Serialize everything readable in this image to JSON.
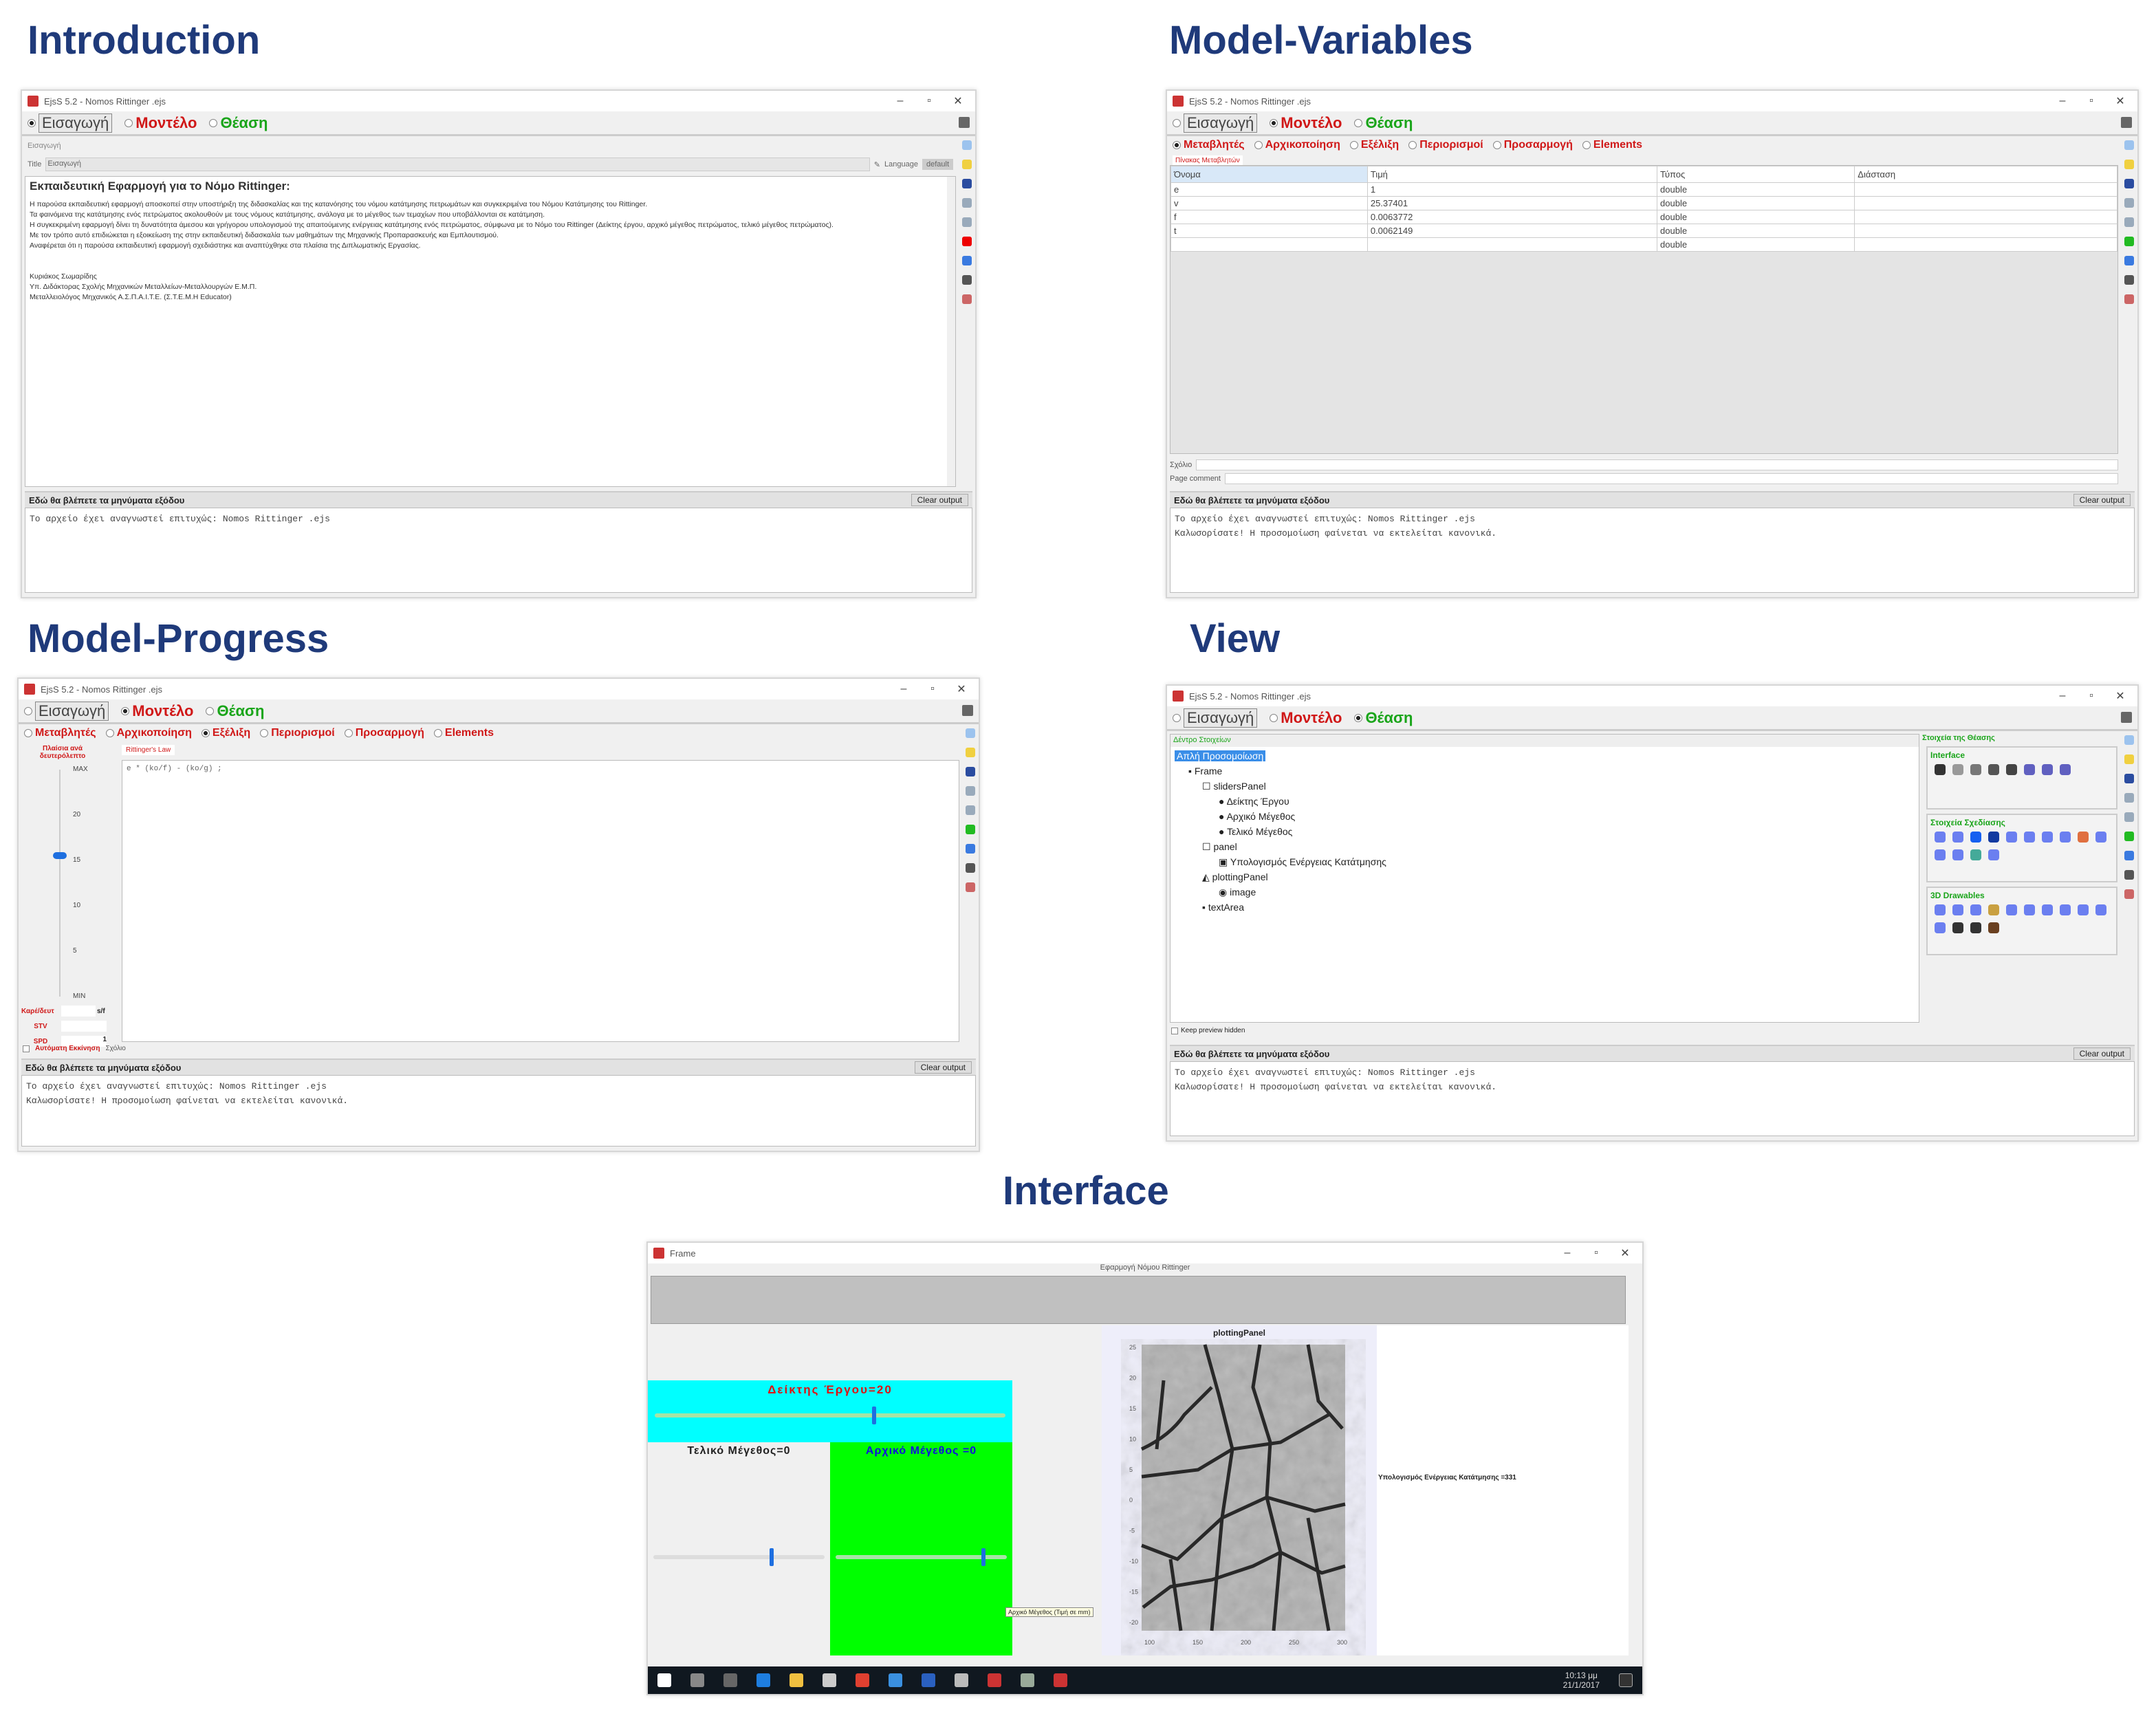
{
  "sections": {
    "introduction": "Introduction",
    "model_variables": "Model-Variables",
    "model_progress": "Model-Progress",
    "view": "View",
    "interface": "Interface"
  },
  "window_title": "EjsS 5.2 - Nomos Rittinger .ejs",
  "modes": {
    "intro": "Εισαγωγή",
    "model": "Μοντέλο",
    "view": "Θέαση"
  },
  "model_tabs": [
    "Μεταβλητές",
    "Αρχικοποίηση",
    "Εξέλιξη",
    "Περιορισμοί",
    "Προσαρμογή",
    "Elements"
  ],
  "output": {
    "header": "Εδώ θα βλέπετε τα μηνύματα εξόδου",
    "clear": "Clear output",
    "line1": "Το αρχείο έχει αναγνωστεί επιτυχώς: Nomos Rittinger .ejs",
    "line2": "Καλωσορίσατε! Η προσομοίωση φαίνεται να εκτελείται κανονικά."
  },
  "intro": {
    "page_tab": "Εισαγωγή",
    "title_label": "Title",
    "title_value": "Εισαγωγή",
    "language_label": "Language",
    "language_value": "default",
    "heading": "Εκπαιδευτική Εφαρμογή για το Νόμο Rittinger:",
    "paragraphs": [
      "Η παρούσα εκπαιδευτική εφαρμογή αποσκοπεί στην υποστήριξη της διδασκαλίας και της κατανόησης του νόμου κατάτμησης πετρωμάτων και συγκεκριμένα του Νόμου Κατάτμησης του Rittinger.",
      "Τα φαινόμενα της κατάτμησης ενός πετρώματος ακολουθούν με τους νόμους κατάτμησης, ανάλογα με το μέγεθος των τεμαχίων που υποβάλλονται σε κατάτμηση.",
      "Η συγκεκριμένη εφαρμογή δίνει τη δυνατότητα άμεσου και γρήγορου υπολογισμού της απαιτούμενης ενέργειας κατάτμησης ενός πετρώματος, σύμφωνα με το Νόμο του Rittinger (Δείκτης έργου, αρχικό μέγεθος πετρώματος, τελικό μέγεθος πετρώματος).",
      "Με τον τρόπο αυτό επιδιώκεται η εξοικείωση της στην εκπαιδευτική διδασκαλία των μαθημάτων της Μηχανικής Προπαρασκευής και Εμπλουτισμού.",
      "Αναφέρεται ότι η παρούσα εκπαιδευτική εφαρμογή σχεδιάστηκε και αναπτύχθηκε στα πλαίσια της Διπλωματικής Εργασίας."
    ],
    "signature": [
      "Κυριάκος Σωμαρίδης",
      "Υπ. Διδάκτορας Σχολής Μηχανικών Μεταλλείων-Μεταλλουργών Ε.Μ.Π.",
      "Μεταλλειολόγος Μηχανικός Α.Σ.Π.Α.Ι.Τ.Ε. (Σ.Τ.Ε.Μ.Η Educator)"
    ]
  },
  "variables": {
    "page_tab": "Πίνακας Μεταβλητών",
    "columns": [
      "Όνομα",
      "Τιμή",
      "Τύπος",
      "Διάσταση"
    ],
    "rows": [
      [
        "e",
        "1",
        "double",
        ""
      ],
      [
        "v",
        "25.37401",
        "double",
        ""
      ],
      [
        "f",
        "0.0063772",
        "double",
        ""
      ],
      [
        "t",
        "0.0062149",
        "double",
        ""
      ],
      [
        "",
        "",
        "double",
        ""
      ]
    ],
    "comment_label": "Σχόλιο",
    "page_comment": "Page comment"
  },
  "progress": {
    "fps_label": "Πλαίσια ανά δευτερόλεπτο",
    "ticks": [
      "MAX",
      "20",
      "15",
      "10",
      "5",
      "MIN"
    ],
    "fps_value_fraction": 0.62,
    "fields": [
      {
        "label": "Καρέ/δευτ",
        "unit": "s/f",
        "value": ""
      },
      {
        "label": "STV",
        "value": ""
      },
      {
        "label": "SPD",
        "value": "1"
      }
    ],
    "autostart": "Αυτόματη Εκκίνηση",
    "comment": "Σχόλιο",
    "page_tab": "Rittinger's Law",
    "code": "e * (ko/f) - (ko/g) ;"
  },
  "view_editor": {
    "tree_title": "Δέντρο Στοιχείων",
    "tree": [
      "Απλή Προσομοίωση",
      "Frame",
      "slidersPanel",
      "Δείκτης Έργου",
      "Αρχικό Μέγεθος",
      "Τελικό Μέγεθος",
      "panel",
      "Υπολογισμός Ενέργειας Κατάτμησης",
      "plottingPanel",
      "image",
      "textArea"
    ],
    "palette_title": "Στοιχεία της Θέασης",
    "palettes": [
      "Interface",
      "Στοιχεία Σχεδίασης",
      "3D Drawables"
    ],
    "keep_hidden": "Keep preview hidden"
  },
  "interface": {
    "title": "Frame",
    "header": "Εφαρμογή Νόμου Rittinger",
    "work_index": "Δείκτης Έργου=20",
    "work_index_fraction": 0.62,
    "final_size": "Τελικό Μέγεθος=0",
    "final_fraction": 0.68,
    "initial_size": "Αρχικό Μέγεθος =0",
    "initial_fraction": 0.85,
    "plot_title": "plottingPanel",
    "y_ticks": [
      "25",
      "20",
      "15",
      "10",
      "5",
      "0",
      "-5",
      "-10",
      "-15",
      "-20"
    ],
    "x_ticks": [
      "100",
      "150",
      "200",
      "250",
      "300"
    ],
    "result": "Υπολογισμός Ενέργειας Κατάτμησης =331",
    "tooltip": "Αρχικό Μέγεθος (Τιμή σε mm)",
    "time": "10:13 μμ",
    "date": "21/1/2017"
  },
  "colors": {
    "title": "#1f3a7a",
    "red": "#d01818",
    "green": "#1aa51a",
    "cyan": "#00ffff",
    "lime": "#00ff00"
  }
}
